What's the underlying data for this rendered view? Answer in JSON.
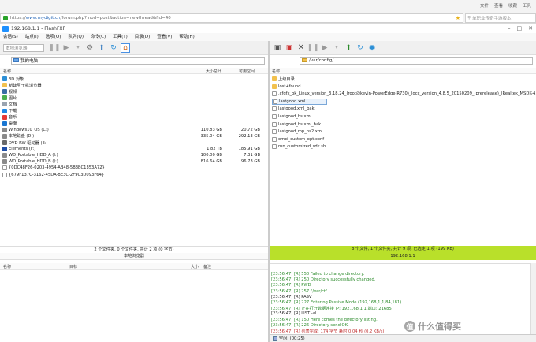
{
  "browser": {
    "url_prefix": "https://",
    "url_host": "www.mydigit.cn",
    "url_path": "/forum.php?mod=post&action=newthread&fid=40",
    "menu": [
      "文件",
      "查看",
      "收藏",
      "工具"
    ],
    "search_placeholder": "单职业传奇手游版本"
  },
  "window": {
    "title": "192.168.1.1 - FlashFXP",
    "controls": [
      "–",
      "□",
      "✕"
    ]
  },
  "menubar": [
    "会话(S)",
    "站点(I)",
    "选项(O)",
    "队列(Q)",
    "命令(C)",
    "工具(T)",
    "目录(D)",
    "查看(V)",
    "帮助(H)"
  ],
  "left": {
    "toolbar_label": "本地浏览器",
    "path": "我的电脑",
    "headers": {
      "name": "名称",
      "size": "大小总计",
      "free": "可用空间"
    },
    "items": [
      {
        "name": "3D 对象",
        "size": "",
        "free": "",
        "icon": "folder-3d-icon"
      },
      {
        "name": "新建至于机浏览器",
        "size": "",
        "free": "",
        "icon": "folder-icon"
      },
      {
        "name": "视频",
        "size": "",
        "free": "",
        "icon": "video-icon"
      },
      {
        "name": "图片",
        "size": "",
        "free": "",
        "icon": "picture-icon"
      },
      {
        "name": "文档",
        "size": "",
        "free": "",
        "icon": "document-icon"
      },
      {
        "name": "下载",
        "size": "",
        "free": "",
        "icon": "download-icon"
      },
      {
        "name": "音乐",
        "size": "",
        "free": "",
        "icon": "music-icon"
      },
      {
        "name": "桌面",
        "size": "",
        "free": "",
        "icon": "desktop-icon"
      },
      {
        "name": "Windows10_OS (C:)",
        "size": "110.83 GB",
        "free": "20.72 GB",
        "icon": "drive-icon"
      },
      {
        "name": "本地磁盘 (D:)",
        "size": "335.04 GB",
        "free": "292.13 GB",
        "icon": "drive-icon"
      },
      {
        "name": "DVD RW 驱动器 (E:)",
        "size": "",
        "free": "",
        "icon": "dvd-icon"
      },
      {
        "name": "Elements (F:)",
        "size": "1.82 TB",
        "free": "185.91 GB",
        "icon": "drive-blue-icon"
      },
      {
        "name": "WD_Portable_HDD_A (I:)",
        "size": "100.00 GB",
        "free": "7.31 GB",
        "icon": "drive-icon"
      },
      {
        "name": "WD_Portable_HDD_B (J:)",
        "size": "816.64 GB",
        "free": "96.73 GB",
        "icon": "drive-icon"
      },
      {
        "name": "{0DC48F26-0203-4954-AB48-5B3BC1353A72}",
        "size": "",
        "free": "",
        "icon": "file-icon"
      },
      {
        "name": "{679F137C-3162-45DA-BE3C-2F9C3D093F64}",
        "size": "",
        "free": "",
        "icon": "file-icon"
      }
    ],
    "status_line1": "2 个文件夹, 0 个文件夹, 共计 2 项 (0 字节)",
    "status_line2": "本地浏览器"
  },
  "right": {
    "path": "/var/config/",
    "headers": {
      "name": "名称"
    },
    "items": [
      {
        "name": "上级目录",
        "icon": "up-icon"
      },
      {
        "name": "lost+found",
        "icon": "folder-icon"
      },
      {
        "name": ".cfgfx_ok_Linux_version_3.18.24_(root@kevin-PowerEdge-R730)_(gcc_version_4.8.5_20150209_(prerelease)_(Realtek_MSDK-4.8.5p1_Build_2521))_#2_SMP_Thu_Apr_15_18:27:00_CST_2021",
        "icon": "file-icon"
      },
      {
        "name": "lastgood.xml",
        "icon": "file-icon",
        "selected": true
      },
      {
        "name": "lastgood.xml_bak",
        "icon": "file-icon"
      },
      {
        "name": "lastgood_hs.xml",
        "icon": "file-icon"
      },
      {
        "name": "lastgood_hs.xml_bak",
        "icon": "file-icon"
      },
      {
        "name": "lastgood_mp_hs2.xml",
        "icon": "file-icon"
      },
      {
        "name": "omci_custom_opt.conf",
        "icon": "file-icon"
      },
      {
        "name": "run_customized_sdk.sh",
        "icon": "file-icon"
      }
    ],
    "status_line1": "8 个文件, 1 个文件夹, 共计 9 项, 已选定 1 项 (199 KB)",
    "status_line2": "192.168.1.1",
    "status_color": "#b9e02a"
  },
  "queue": {
    "headers": {
      "name": "名称",
      "target": "目标",
      "size": "大小",
      "remark": "备注"
    }
  },
  "log": {
    "lines": [
      {
        "text": "[23:56:47] [R] 550 Failed to change directory.",
        "color": "#2a8a2a"
      },
      {
        "text": "[23:56:47] [R] 250 Directory successfully changed.",
        "color": "#2a8a2a"
      },
      {
        "text": "[23:56:47] [R] PWD",
        "color": "#2a8a2a"
      },
      {
        "text": "[23:56:47] [R] 257 \"/var/ct\"",
        "color": "#2a8a2a"
      },
      {
        "text": "[23:56:47] [R] PASV",
        "color": "#222222"
      },
      {
        "text": "[23:56:47] [R] 227 Entering Passive Mode (192,168,1,1,84,181).",
        "color": "#2a8a2a"
      },
      {
        "text": "[23:56:47] [R] 正在打开数据连接 IP: 192.168.1.1 端口: 21685",
        "color": "#2a8a2a"
      },
      {
        "text": "[23:56:47] [R] LIST -al",
        "color": "#222222"
      },
      {
        "text": "[23:56:47] [R] 150 Here comes the directory listing.",
        "color": "#2a8a2a"
      },
      {
        "text": "[23:56:47] [R] 226 Directory send OK.",
        "color": "#2a8a2a"
      },
      {
        "text": "[23:56:47] [R] 列表完成: 174 字节 耗时 0.04 秒 (0.2 KB/s)",
        "color": "#c03030"
      }
    ],
    "footer_label": "空闲. (00:25)"
  },
  "watermark": {
    "badge": "值",
    "text": "什么值得买"
  }
}
